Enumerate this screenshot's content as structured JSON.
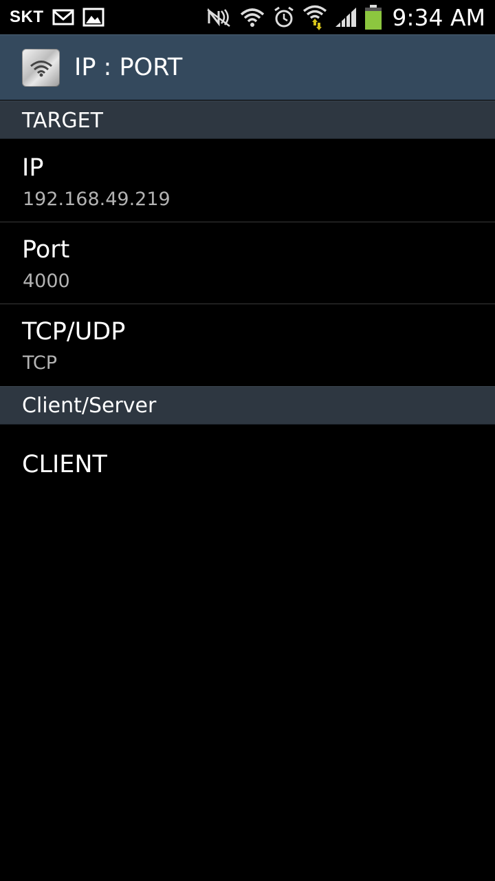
{
  "status_bar": {
    "carrier": "SKT",
    "time": "9:34 AM",
    "icons": [
      "gmail-icon",
      "gallery-icon",
      "nfc-off-icon",
      "wifi-icon",
      "alarm-icon",
      "wifi-data-icon",
      "signal-icon",
      "battery-icon"
    ],
    "battery_color": "#8cc63f",
    "data_arrow_color": "#d4c21a"
  },
  "action_bar": {
    "app_icon": "wifi-app-icon",
    "title": "IP : PORT",
    "background": "#34495d"
  },
  "sections": {
    "target": {
      "header": "TARGET",
      "items": [
        {
          "title": "IP",
          "summary": "192.168.49.219"
        },
        {
          "title": "Port",
          "summary": "4000"
        },
        {
          "title": "TCP/UDP",
          "summary": "TCP"
        }
      ]
    },
    "client_server": {
      "header": "Client/Server",
      "items": [
        {
          "title": "CLIENT"
        }
      ]
    }
  }
}
